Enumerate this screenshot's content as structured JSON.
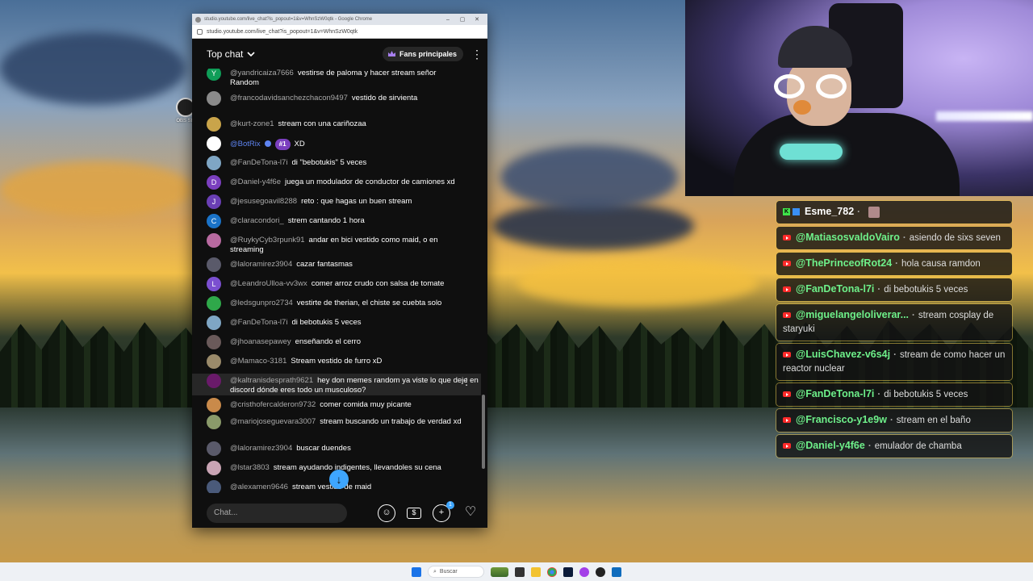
{
  "desktop": {
    "icon_label": "OBS Stu"
  },
  "browser": {
    "title": "studio.youtube.com/live_chat?is_popout=1&v=WhnSzW0qtk - Google Chrome",
    "url": "studio.youtube.com/live_chat?is_popout=1&v=WhnSzW0qtk",
    "window_controls": [
      "–",
      "▢",
      "✕"
    ]
  },
  "chat": {
    "mode_label": "Top chat",
    "fans_label": "Fans principales",
    "input_placeholder": "Chat...",
    "notification_count": "1",
    "messages": [
      {
        "author": "@yandricaiza7666",
        "text": "vestirse de paloma y hacer stream señor Random",
        "avatar_letter": "Y",
        "avatar_color": "#0f9d58"
      },
      {
        "author": "@francodavidsanchezchacon9497",
        "text": "vestido de sirvienta",
        "avatar_letter": "",
        "avatar_color": "#8a8a8a"
      },
      {
        "author": "@kurt-zone1",
        "text": "stream con una cariñozaa",
        "avatar_letter": "",
        "avatar_color": "#c9a44a"
      },
      {
        "author": "@BotRix",
        "text": "XD",
        "avatar_letter": "",
        "avatar_color": "#ffffff",
        "moderator": true,
        "rank": "#1"
      },
      {
        "author": "@FanDeTona-l7i",
        "text": "di \"bebotukis\" 5 veces",
        "avatar_letter": "",
        "avatar_color": "#7fa6c4"
      },
      {
        "author": "@Daniel-y4f6e",
        "text": "juega un modulador de conductor de camiones xd",
        "avatar_letter": "D",
        "avatar_color": "#7b3fbf"
      },
      {
        "author": "@jesusegoavil8288",
        "text": "reto : que hagas un buen stream",
        "avatar_letter": "J",
        "avatar_color": "#6a3fb5"
      },
      {
        "author": "@claracondori_",
        "text": "strem cantando 1 hora",
        "avatar_letter": "C",
        "avatar_color": "#1a73c8"
      },
      {
        "author": "@RuykyCyb3rpunk91",
        "text": "andar en bici vestido como maid, o en streaming",
        "avatar_letter": "",
        "avatar_color": "#b86aa0"
      },
      {
        "author": "@laloramirez3904",
        "text": "cazar fantasmas",
        "avatar_letter": "",
        "avatar_color": "#5a5a6a"
      },
      {
        "author": "@LeandroUlloa-vv3wx",
        "text": "comer arroz crudo con salsa de tomate",
        "avatar_letter": "L",
        "avatar_color": "#7b4fd0"
      },
      {
        "author": "@ledsgunpro2734",
        "text": "vestirte de therian, el chiste se cuebta solo",
        "avatar_letter": "",
        "avatar_color": "#2fa84a"
      },
      {
        "author": "@FanDeTona-l7i",
        "text": "di bebotukis 5 veces",
        "avatar_letter": "",
        "avatar_color": "#7fa6c4"
      },
      {
        "author": "@jhoanasepawey",
        "text": "enseñando el cerro",
        "avatar_letter": "",
        "avatar_color": "#6a5a5a"
      },
      {
        "author": "@Mamaco-3181",
        "text": "Stream vestido de furro xD",
        "avatar_letter": "",
        "avatar_color": "#9a8a6a"
      },
      {
        "author": "@kaltranisdesprath9621",
        "text": "hey don memes random ya viste lo que deje en discord dónde eres todo un musculoso?",
        "avatar_letter": "",
        "avatar_color": "#6a1a6a"
      },
      {
        "author": "@cristhofercalderon9732",
        "text": "comer comida muy picante",
        "avatar_letter": "",
        "avatar_color": "#c98a4a"
      },
      {
        "author": "@mariojoseguevara3007",
        "text": "stream buscando un trabajo de verdad xd",
        "avatar_letter": "",
        "avatar_color": "#8a9a6a"
      },
      {
        "author": "@laloramirez3904",
        "text": "buscar duendes",
        "avatar_letter": "",
        "avatar_color": "#5a5a6a"
      },
      {
        "author": "@lstar3803",
        "text": "stream ayudando indigentes, llevandoles su cena",
        "avatar_letter": "",
        "avatar_color": "#c9a4b4"
      },
      {
        "author": "@alexamen9646",
        "text": "stream vestido de maid",
        "avatar_letter": "",
        "avatar_color": "#4a5a7a"
      }
    ]
  },
  "overlay": {
    "messages": [
      {
        "platform": "kick",
        "author": "Esme_782",
        "text": ""
      },
      {
        "platform": "youtube",
        "author": "@MatiasosvaldoVairo",
        "text": "asiendo de sixs seven"
      },
      {
        "platform": "youtube",
        "author": "@ThePrinceofRot24",
        "text": "hola causa ramdon"
      },
      {
        "platform": "youtube",
        "author": "@FanDeTona-l7i",
        "text": "di bebotukis 5 veces"
      },
      {
        "platform": "youtube",
        "author": "@miguelangeloliverar...",
        "text": "stream cosplay de staryuki"
      },
      {
        "platform": "youtube",
        "author": "@LuisChavez-v6s4j",
        "text": "stream de como hacer un reactor nuclear"
      },
      {
        "platform": "youtube",
        "author": "@FanDeTona-l7i",
        "text": "di bebotukis 5 veces"
      },
      {
        "platform": "youtube",
        "author": "@Francisco-y1e9w",
        "text": "stream en el baño"
      },
      {
        "platform": "youtube",
        "author": "@Daniel-y4f6e",
        "text": "emulador de chamba"
      }
    ]
  },
  "taskbar": {
    "search_label": "Buscar"
  }
}
